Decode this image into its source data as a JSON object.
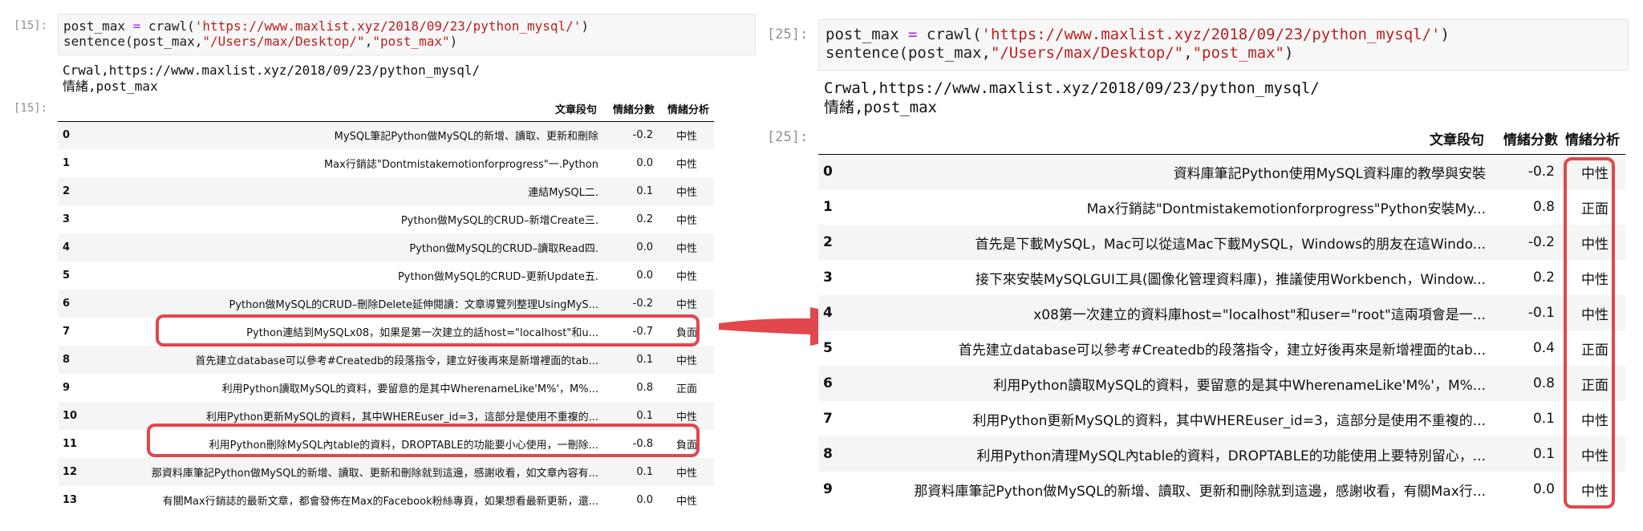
{
  "left": {
    "in_prompt": "[15]:",
    "out_prompt": "[15]:",
    "code": {
      "line1": {
        "var": "post_max",
        "eq": "=",
        "fn": "crawl(",
        "url": "'https://www.maxlist.xyz/2018/09/23/python_mysql/'",
        "close": ")"
      },
      "line2": {
        "fn": "sentence(post_max,",
        "path": "\"/Users/max/Desktop/\"",
        "comma": ",",
        "name": "\"post_max\"",
        "close": ")"
      }
    },
    "stdout": [
      "Crwal,https://www.maxlist.xyz/2018/09/23/python_mysql/",
      "情緒,post_max"
    ],
    "columns": [
      "文章段句",
      "情緒分數",
      "情緒分析"
    ],
    "rows": [
      {
        "i": "0",
        "text": "MySQL筆記Python做MySQL的新增、讀取、更新和刪除",
        "score": "-0.2",
        "label": "中性"
      },
      {
        "i": "1",
        "text": "Max行銷誌\"Dontmistakemotionforprogress\"一.Python",
        "score": "0.0",
        "label": "中性"
      },
      {
        "i": "2",
        "text": "連結MySQL二.",
        "score": "0.1",
        "label": "中性"
      },
      {
        "i": "3",
        "text": "Python做MySQL的CRUD–新增Create三.",
        "score": "0.2",
        "label": "中性"
      },
      {
        "i": "4",
        "text": "Python做MySQL的CRUD–讀取Read四.",
        "score": "0.0",
        "label": "中性"
      },
      {
        "i": "5",
        "text": "Python做MySQL的CRUD–更新Update五.",
        "score": "0.0",
        "label": "中性"
      },
      {
        "i": "6",
        "text": "Python做MySQL的CRUD–刪除Delete延伸閱讀：文章導覽列整理UsingMyS...",
        "score": "-0.2",
        "label": "中性"
      },
      {
        "i": "7",
        "text": "Python連結到MySQLx08，如果是第一次建立的話host=\"localhost\"和u...",
        "score": "-0.7",
        "label": "負面"
      },
      {
        "i": "8",
        "text": "首先建立database可以參考#Createdb的段落指令，建立好後再來是新增裡面的tab...",
        "score": "0.1",
        "label": "中性"
      },
      {
        "i": "9",
        "text": "利用Python讀取MySQL的資料，要留意的是其中WherenameLike'M%'，M%...",
        "score": "0.8",
        "label": "正面"
      },
      {
        "i": "10",
        "text": "利用Python更新MySQL的資料，其中WHEREuser_id=3，這部分是使用不重複的...",
        "score": "0.1",
        "label": "中性"
      },
      {
        "i": "11",
        "text": "利用Python刪除MySQL內table的資料，DROPTABLE的功能要小心使用，一刪除...",
        "score": "-0.8",
        "label": "負面"
      },
      {
        "i": "12",
        "text": "那資料庫筆記Python做MySQL的新增、讀取、更新和刪除就到這邊，感謝收看，如文章內容有...",
        "score": "0.1",
        "label": "中性"
      },
      {
        "i": "13",
        "text": "有關Max行銷誌的最新文章，都會發佈在Max的Facebook粉絲專頁，如果想看最新更新，還...",
        "score": "0.0",
        "label": "中性"
      }
    ]
  },
  "right": {
    "in_prompt": "[25]:",
    "out_prompt": "[25]:",
    "code": {
      "line1": {
        "var": "post_max",
        "eq": "=",
        "fn": "crawl(",
        "url": "'https://www.maxlist.xyz/2018/09/23/python_mysql/'",
        "close": ")"
      },
      "line2": {
        "fn": "sentence(post_max,",
        "path": "\"/Users/max/Desktop/\"",
        "comma": ",",
        "name": "\"post_max\"",
        "close": ")"
      }
    },
    "stdout": [
      "Crwal,https://www.maxlist.xyz/2018/09/23/python_mysql/",
      "情緒,post_max"
    ],
    "columns": [
      "文章段句",
      "情緒分數",
      "情緒分析"
    ],
    "rows": [
      {
        "i": "0",
        "text": "資料庫筆記Python使用MySQL資料庫的教學與安裝",
        "score": "-0.2",
        "label": "中性"
      },
      {
        "i": "1",
        "text": "Max行銷誌\"Dontmistakemotionforprogress\"Python安裝My...",
        "score": "0.8",
        "label": "正面"
      },
      {
        "i": "2",
        "text": "首先是下載MySQL，Mac可以從這Mac下載MySQL，Windows的朋友在這Windo...",
        "score": "-0.2",
        "label": "中性"
      },
      {
        "i": "3",
        "text": "接下來安裝MySQLGUI工具(圖像化管理資料庫)，推議使用Workbench，Window...",
        "score": "0.2",
        "label": "中性"
      },
      {
        "i": "4",
        "text": "x08第一次建立的資料庫host=\"localhost\"和user=\"root\"這兩項會是一...",
        "score": "-0.1",
        "label": "中性"
      },
      {
        "i": "5",
        "text": "首先建立database可以參考#Createdb的段落指令，建立好後再來是新增裡面的tab...",
        "score": "0.4",
        "label": "正面"
      },
      {
        "i": "6",
        "text": "利用Python讀取MySQL的資料，要留意的是其中WherenameLike'M%'，M%...",
        "score": "0.8",
        "label": "正面"
      },
      {
        "i": "7",
        "text": "利用Python更新MySQL的資料，其中WHEREuser_id=3，這部分是使用不重複的...",
        "score": "0.1",
        "label": "中性"
      },
      {
        "i": "8",
        "text": "利用Python清理MySQL內table的資料，DROPTABLE的功能使用上要特別留心，...",
        "score": "0.1",
        "label": "中性"
      },
      {
        "i": "9",
        "text": "那資料庫筆記Python做MySQL的新增、讀取、更新和刪除就到這邊，感謝收看，有關Max行...",
        "score": "0.0",
        "label": "中性"
      }
    ]
  },
  "colors": {
    "highlight": "#e2474b",
    "string": "#ba2121",
    "operator": "#aa22ff",
    "prompt": "#8f8f8f"
  }
}
